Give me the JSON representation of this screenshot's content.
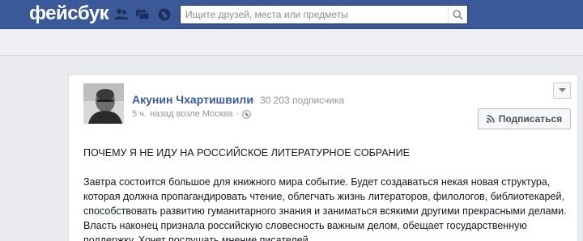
{
  "header": {
    "logo_text": "фейсбук",
    "search": {
      "placeholder": "Ищите друзей, места или предметы",
      "value": ""
    }
  },
  "colors": {
    "header_bg": "#3b5998",
    "link": "#3b5998",
    "page_bg": "#e9ebee"
  },
  "icons": {
    "friends": "friends-icon",
    "messages": "messages-icon",
    "notifications": "globe-icon",
    "search": "search-icon",
    "privacy": "globe-icon",
    "subscribe": "rss-icon",
    "menu": "chevron-down-icon"
  },
  "post": {
    "author": "Акунин Чхартишвили",
    "separator": "·",
    "subscribers": "30 203 подписчика",
    "time": "5 ч.",
    "location": "назад возле Москва",
    "meta_separator": "·",
    "subscribe_label": "Подписаться",
    "title": "ПОЧЕМУ Я НЕ ИДУ НА РОССИЙСКОЕ ЛИТЕРАТУРНОЕ СОБРАНИЕ",
    "body": "Завтра состоится большое для книжного мира событие. Будет создаваться некая новая структура, которая должна пропагандировать чтение, облегчать жизнь литераторов, филологов, библиотекарей, способствовать развитию гуманитарного знания и заниматься всякими другими прекрасными делами. Власть наконец признала российскую словесность важным делом, обещает государственную поддержку. Хочет послушать мнение писателей."
  }
}
